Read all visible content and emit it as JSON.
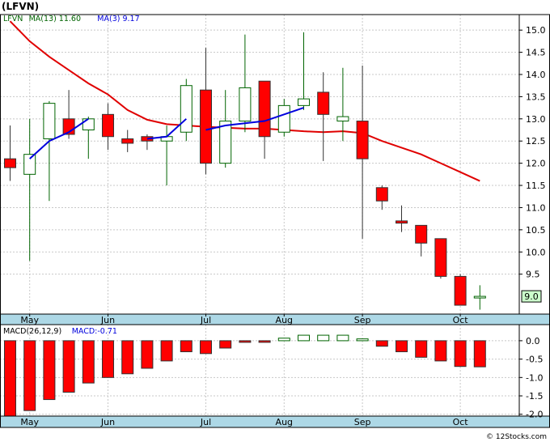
{
  "title": "(LFVN)",
  "footer": "© 12Stocks.com",
  "colors": {
    "up_candle": "#ffffff",
    "up_border": "#006400",
    "down_candle": "#ff0000",
    "ma13": "#e00000",
    "ma3": "#0000dd",
    "macd_bar": "#ff0000",
    "macd_bar_pos": "#ffffff",
    "grid": "#c8c8c8",
    "axis_band": "#add8e6",
    "last_price_box": "#ccffcc"
  },
  "chart_data": [
    {
      "type": "candlestick",
      "legend": [
        {
          "name": "LFVN",
          "color": "#006400"
        },
        {
          "name": "MA(13)",
          "value": "11.60",
          "color": "#006400"
        },
        {
          "name": "MA(3)",
          "value": "9.17",
          "color": "#0000dd"
        }
      ],
      "ylim": [
        8.6,
        15.35
      ],
      "yticks": [
        "15.0",
        "14.5",
        "14.0",
        "13.5",
        "13.0",
        "12.5",
        "12.0",
        "11.5",
        "11.0",
        "10.5",
        "10.0",
        "9.5"
      ],
      "yticks_values": [
        15.0,
        14.5,
        14.0,
        13.5,
        13.0,
        12.5,
        12.0,
        11.5,
        11.0,
        10.5,
        10.0,
        9.5
      ],
      "last_price_label": "9.0",
      "last_price": 9.0,
      "months": [
        {
          "label": "May",
          "week": 1
        },
        {
          "label": "Jun",
          "week": 5
        },
        {
          "label": "Jul",
          "week": 10
        },
        {
          "label": "Aug",
          "week": 14
        },
        {
          "label": "Sep",
          "week": 18
        },
        {
          "label": "Oct",
          "week": 23
        }
      ],
      "candles": [
        {
          "o": 12.1,
          "h": 12.85,
          "l": 11.6,
          "c": 11.9
        },
        {
          "o": 11.75,
          "h": 13.0,
          "l": 9.8,
          "c": 12.2
        },
        {
          "o": 12.55,
          "h": 13.4,
          "l": 11.15,
          "c": 13.35
        },
        {
          "o": 13.0,
          "h": 13.65,
          "l": 12.55,
          "c": 12.65
        },
        {
          "o": 12.75,
          "h": 13.05,
          "l": 12.1,
          "c": 13.0
        },
        {
          "o": 13.1,
          "h": 13.35,
          "l": 12.3,
          "c": 12.6
        },
        {
          "o": 12.55,
          "h": 12.75,
          "l": 12.25,
          "c": 12.45
        },
        {
          "o": 12.6,
          "h": 12.65,
          "l": 12.3,
          "c": 12.5
        },
        {
          "o": 12.5,
          "h": 12.85,
          "l": 11.5,
          "c": 12.6
        },
        {
          "o": 12.7,
          "h": 13.9,
          "l": 12.5,
          "c": 13.75
        },
        {
          "o": 13.65,
          "h": 14.6,
          "l": 11.75,
          "c": 12.0
        },
        {
          "o": 12.0,
          "h": 13.65,
          "l": 11.9,
          "c": 12.95
        },
        {
          "o": 12.95,
          "h": 14.9,
          "l": 12.7,
          "c": 13.7
        },
        {
          "o": 13.85,
          "h": 13.85,
          "l": 12.1,
          "c": 12.6
        },
        {
          "o": 12.7,
          "h": 13.45,
          "l": 12.6,
          "c": 13.3
        },
        {
          "o": 13.3,
          "h": 14.95,
          "l": 13.2,
          "c": 13.45
        },
        {
          "o": 13.6,
          "h": 14.05,
          "l": 12.05,
          "c": 13.1
        },
        {
          "o": 12.95,
          "h": 14.15,
          "l": 12.5,
          "c": 13.05
        },
        {
          "o": 12.95,
          "h": 14.2,
          "l": 10.3,
          "c": 12.1
        },
        {
          "o": 11.45,
          "h": 11.5,
          "l": 10.95,
          "c": 11.15
        },
        {
          "o": 10.7,
          "h": 11.05,
          "l": 10.45,
          "c": 10.65
        },
        {
          "o": 10.6,
          "h": 10.6,
          "l": 9.9,
          "c": 10.2
        },
        {
          "o": 10.3,
          "h": 10.3,
          "l": 9.4,
          "c": 9.45
        },
        {
          "o": 9.45,
          "h": 9.5,
          "l": 8.8,
          "c": 8.8
        },
        {
          "o": 9.0,
          "h": 9.25,
          "l": 8.7,
          "c": 9.0
        }
      ],
      "ma13": [
        15.2,
        14.75,
        14.4,
        14.1,
        13.8,
        13.55,
        13.2,
        12.98,
        12.88,
        12.85,
        12.82,
        12.8,
        12.78,
        12.78,
        12.75,
        12.72,
        12.7,
        12.72,
        12.68,
        12.5,
        12.35,
        12.2,
        12.0,
        11.8,
        11.6
      ],
      "ma3": [
        null,
        12.1,
        12.5,
        12.7,
        13.0,
        null,
        null,
        null,
        12.55,
        13.0,
        12.8,
        12.75,
        12.85,
        12.9,
        12.95,
        13.1,
        13.25,
        null,
        null,
        null,
        null,
        null,
        null,
        null,
        null
      ],
      "ma3_segments": [
        [
          0,
          4
        ],
        [
          7,
          9
        ],
        [
          10,
          16
        ]
      ],
      "ma3_values": [
        12.1,
        12.1,
        12.5,
        12.7,
        13.0,
        12.55,
        12.52,
        12.55,
        13.0,
        12.8,
        12.75,
        12.85,
        12.9,
        12.95,
        13.1,
        13.25
      ]
    },
    {
      "type": "bar",
      "legend": [
        {
          "name": "MACD(26,12,9)",
          "color": "#000000"
        },
        {
          "name": "MACD:",
          "value": "-0.71",
          "color": "#0000dd"
        }
      ],
      "ylim": [
        -2.05,
        0.35
      ],
      "yticks": [
        "0.0",
        "-0.5",
        "-1.0",
        "-1.5",
        "-2.0"
      ],
      "yticks_values": [
        0.0,
        -0.5,
        -1.0,
        -1.5,
        -2.0
      ],
      "values": [
        -2.05,
        -1.9,
        -1.6,
        -1.4,
        -1.15,
        -1.0,
        -0.9,
        -0.75,
        -0.55,
        -0.3,
        -0.35,
        -0.2,
        -0.02,
        0.0,
        0.07,
        0.15,
        0.15,
        0.15,
        0.05,
        -0.15,
        -0.3,
        -0.45,
        -0.55,
        -0.7,
        -0.71
      ]
    }
  ]
}
